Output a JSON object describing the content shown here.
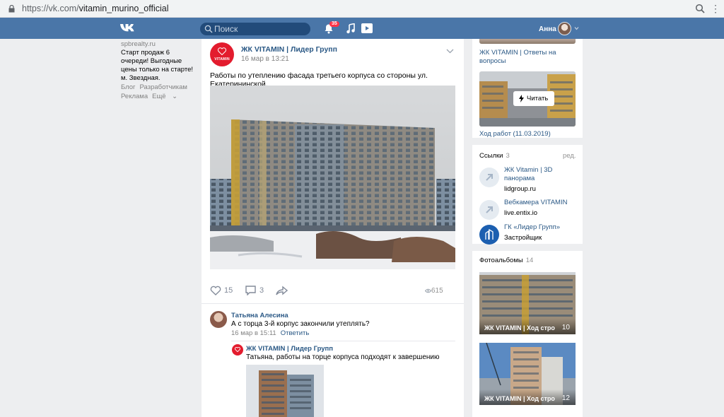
{
  "browser": {
    "url_host": "https://vk.com/",
    "url_path": "vitamin_murino_official"
  },
  "header": {
    "search_placeholder": "Поиск",
    "notifications_badge": "35",
    "user_name": "Анна"
  },
  "left": {
    "ad_domain": "spbrealty.ru",
    "ad_text": "Старт продаж 6 очереди! Выгодные цены только на старте! м. Звездная.",
    "footer": [
      "Блог",
      "Разработчикам",
      "Реклама",
      "Ещё"
    ]
  },
  "post": {
    "author": "ЖК VITAMIN | Лидер Групп",
    "avatar_text": "VITAMIN",
    "date": "16 мар в 13:21",
    "text": "Работы по утеплению фасада третьего корпуса со стороны ул. Екатерининской.",
    "likes": "15",
    "comments": "3",
    "views": "615"
  },
  "comments": [
    {
      "author": "Татьяна Алесина",
      "text": "А с торца 3-й корпус закончили утеплять?",
      "date": "16 мар в 15:11",
      "reply_label": "Ответить"
    },
    {
      "author": "ЖК VITAMIN | Лидер Групп",
      "text": "Татьяна, работы на торце корпуса подходят к завершению"
    }
  ],
  "right": {
    "top_caption": "ЖК VITAMIN | Ответы на вопросы",
    "read_button": "Читать",
    "article_caption": "Ход работ (11.03.2019)",
    "links_title": "Ссылки",
    "links_count": "3",
    "links_edit": "ред.",
    "links": [
      {
        "title": "ЖК Vitamin | 3D панорама",
        "sub": "lidgroup.ru"
      },
      {
        "title": "Вебкамера VITAMIN",
        "sub": "live.entix.io"
      },
      {
        "title": "ГК «Лидер Групп»",
        "sub": "Застройщик"
      }
    ],
    "albums_title": "Фотоальбомы",
    "albums_count": "14",
    "albums": [
      {
        "name": "ЖК VITAMIN | Ход строи",
        "count": "10"
      },
      {
        "name": "ЖК VITAMIN | Ход строи",
        "count": "12"
      }
    ]
  },
  "colors": {
    "header_bg": "#4a76a8",
    "link": "#2a5885",
    "page_bg": "#edeef0",
    "brand_red": "#e31c2e"
  },
  "icons": [
    "lock-icon",
    "vk-logo-icon",
    "search-icon",
    "bell-icon",
    "music-icon",
    "video-icon",
    "chevron-down-icon",
    "heart-icon",
    "comment-icon",
    "share-icon",
    "eye-icon",
    "bolt-icon",
    "arrow-link-icon"
  ]
}
